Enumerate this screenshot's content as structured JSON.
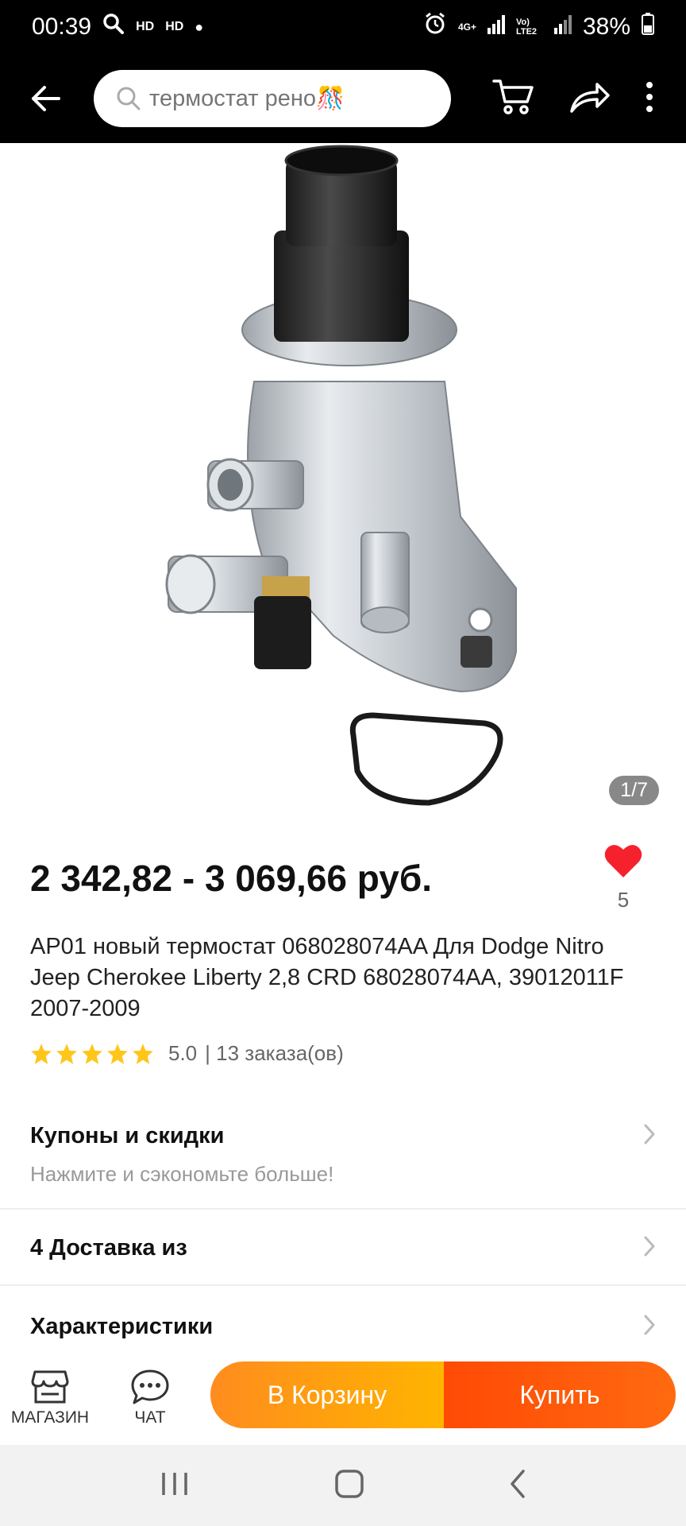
{
  "status_bar": {
    "time": "00:39",
    "hd1": "HD",
    "hd2": "HD",
    "network": "4G+",
    "lte": "Vo) LTE2",
    "battery": "38%"
  },
  "search": {
    "placeholder": "термостат рено🎊"
  },
  "gallery": {
    "counter": "1/7"
  },
  "product": {
    "price": "2 342,82 - 3 069,66 руб.",
    "favorites_count": "5",
    "title": "AP01 новый термостат 068028074AA Для Dodge Nitro Jeep Cherokee Liberty 2,8 CRD 68028074AA, 39012011F 2007-2009",
    "rating_value": "5.0",
    "orders": "| 13 заказа(ов)",
    "stars": 5
  },
  "sections": {
    "coupons_label": "Купоны и скидки",
    "coupons_sub": "Нажмите и сэкономьте больше!",
    "delivery_label": "4 Доставка из",
    "specs_label": "Характеристики"
  },
  "bottom_bar": {
    "store_label": "МАГАЗИН",
    "chat_label": "ЧАТ",
    "cart_button": "В Корзину",
    "buy_button": "Купить"
  },
  "colors": {
    "accent_orange": "#ff8c1e",
    "accent_red": "#ff4a05",
    "heart": "#f5222d",
    "star": "#ffc61a"
  }
}
